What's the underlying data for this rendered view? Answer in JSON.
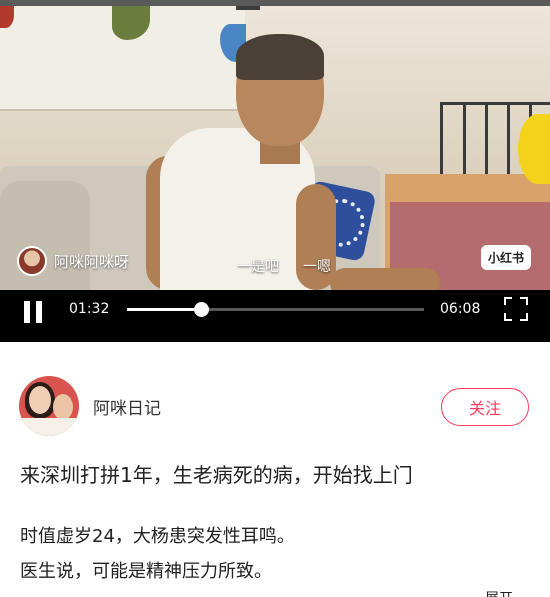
{
  "video": {
    "overlay_author": "阿咪阿咪呀",
    "subtitles": [
      "一是吧",
      "一嗯"
    ],
    "brand_badge": "小红书",
    "current_time": "01:32",
    "total_time": "06:08",
    "progress": 0.25,
    "icons": [
      "pause-icon",
      "fullscreen-icon"
    ]
  },
  "post": {
    "author": "阿咪日记",
    "follow_label": "关注",
    "title": "来深圳打拼1年，生老病死的病，开始找上门",
    "body_lines": [
      "时值虚岁24，大杨患突发性耳鸣。",
      "医生说，可能是精神压力所致。"
    ],
    "cut_off_text": "展开"
  },
  "colors": {
    "accent": "#ff3b5c",
    "control_bar": "#000000"
  }
}
